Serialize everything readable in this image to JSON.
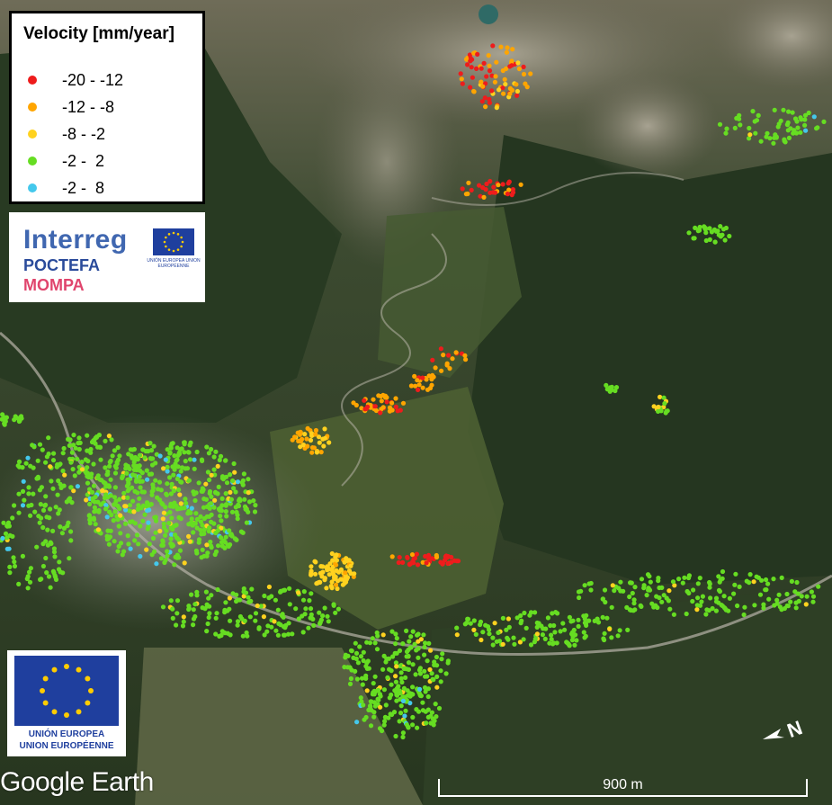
{
  "legend": {
    "title": "Velocity [mm/year]",
    "classes": [
      {
        "label": "-20 - -12",
        "color": "#ee1c1c"
      },
      {
        "label": "-12 - -8",
        "color": "#ffa500"
      },
      {
        "label": "-8 - -2",
        "color": "#ffd21f"
      },
      {
        "label": "-2 -  2",
        "color": "#66dd22"
      },
      {
        "label": "-2 -  8",
        "color": "#44c8ec"
      }
    ]
  },
  "interreg": {
    "name": "Interreg",
    "programme": "POCTEFA",
    "project": "MOMPA",
    "flag_text": "UNIÓN EUROPEA UNION EUROPÉENNE"
  },
  "eu": {
    "line1": "UNIÓN EUROPEA",
    "line2": "UNION EUROPÉENNE"
  },
  "attribution": "Google Earth",
  "scale": {
    "label": "900 m"
  },
  "compass": {
    "label": "N",
    "icon": "north-arrow-icon"
  },
  "colors": {
    "forest": "#2c3f27",
    "meadow": "#5a6b3a",
    "rock": "#8d8a7a",
    "road": "#b8b4a8"
  }
}
